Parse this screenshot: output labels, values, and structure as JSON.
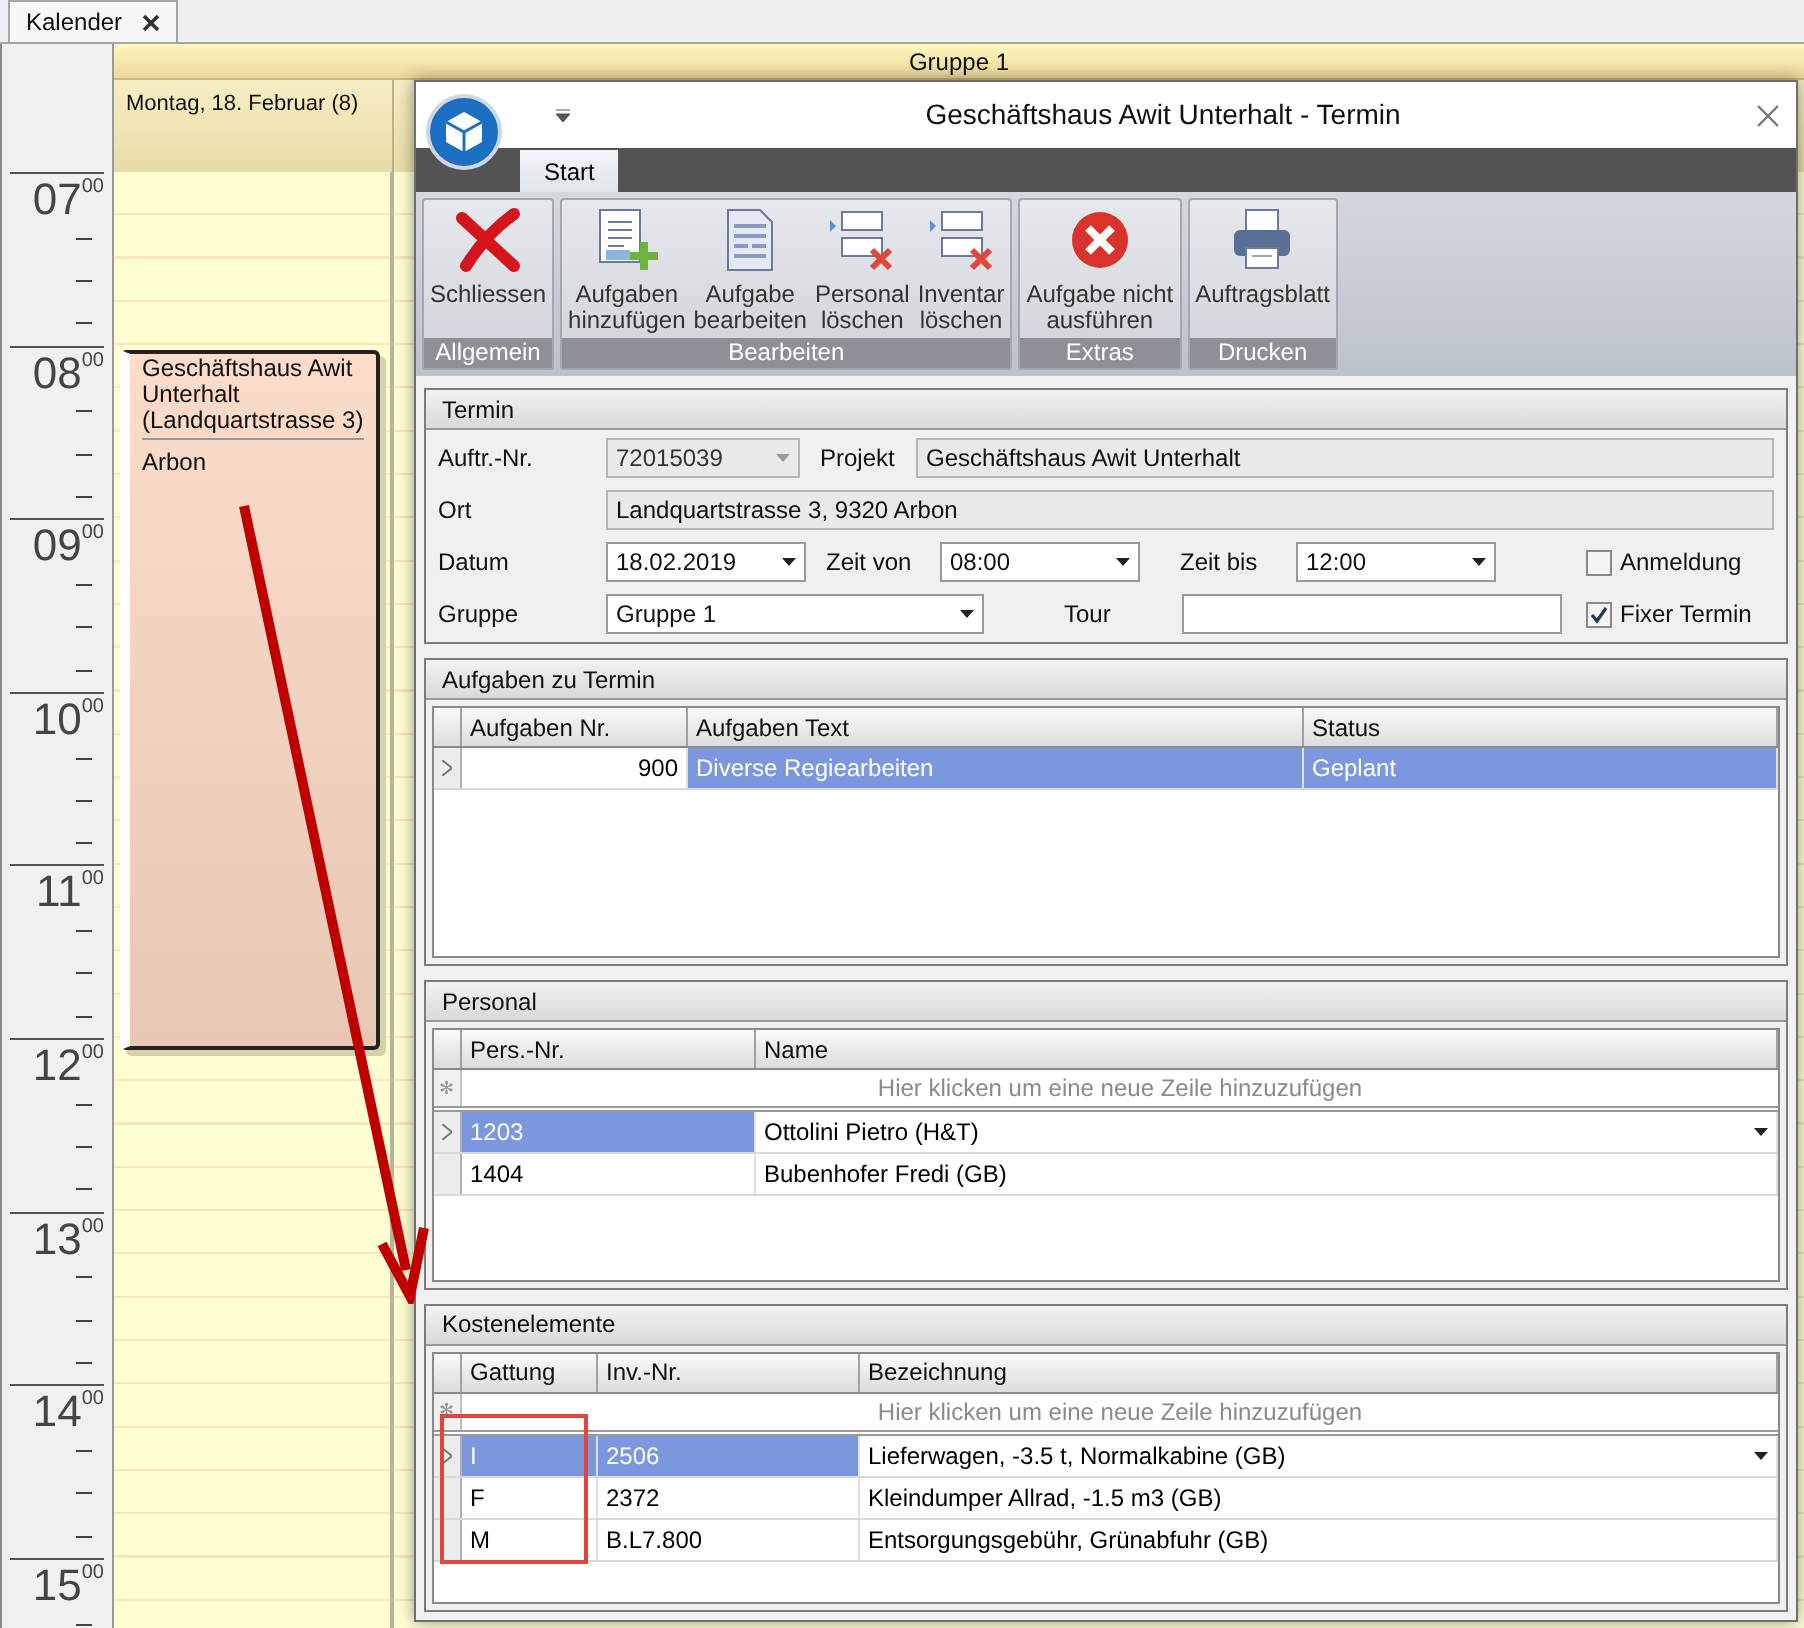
{
  "document_tab": {
    "label": "Kalender"
  },
  "calendar": {
    "group": "Gruppe 1",
    "day_headers": [
      {
        "label": "Montag, 18. Februar (8)"
      }
    ],
    "hours": [
      {
        "hour": "07",
        "minutes": "00"
      },
      {
        "hour": "08",
        "minutes": "00"
      },
      {
        "hour": "09",
        "minutes": "00"
      },
      {
        "hour": "10",
        "minutes": "00"
      },
      {
        "hour": "11",
        "minutes": "00"
      },
      {
        "hour": "12",
        "minutes": "00"
      },
      {
        "hour": "13",
        "minutes": "00"
      },
      {
        "hour": "14",
        "minutes": "00"
      },
      {
        "hour": "15",
        "minutes": "00"
      }
    ],
    "appointment": {
      "title": "Geschäftshaus Awit Unterhalt (Landquartstrasse 3)",
      "location": "Arbon"
    }
  },
  "dialog": {
    "title": "Geschäftshaus Awit Unterhalt - Termin",
    "ribbon_tabs": [
      {
        "label": "Start",
        "selected": true
      }
    ],
    "ribbon_groups": [
      {
        "label": "Allgemein",
        "buttons": [
          {
            "label": "Schliessen",
            "kind": "cross"
          }
        ]
      },
      {
        "label": "Bearbeiten",
        "buttons": [
          {
            "label": "Aufgaben\nhinzufügen",
            "kind": "add-doc"
          },
          {
            "label": "Aufgabe\nbearbeiten",
            "kind": "doc"
          },
          {
            "label": "Personal\nlöschen",
            "kind": "remove-rows"
          },
          {
            "label": "Inventar\nlöschen",
            "kind": "remove-rows"
          }
        ]
      },
      {
        "label": "Extras",
        "buttons": [
          {
            "label": "Aufgabe nicht\nausführen",
            "kind": "stop"
          }
        ]
      },
      {
        "label": "Drucken",
        "buttons": [
          {
            "label": "Auftragsblatt",
            "kind": "printer"
          }
        ]
      }
    ],
    "termin": {
      "title": "Termin",
      "auftr_nr": {
        "label": "Auftr.-Nr.",
        "value": "72015039",
        "disabled": true
      },
      "projekt": {
        "label": "Projekt",
        "value": "Geschäftshaus Awit Unterhalt"
      },
      "ort": {
        "label": "Ort",
        "value": "Landquartstrasse 3, 9320 Arbon"
      },
      "datum": {
        "label": "Datum",
        "value": "18.02.2019"
      },
      "zeit_von": {
        "label": "Zeit von",
        "value": "08:00"
      },
      "zeit_bis": {
        "label": "Zeit bis",
        "value": "12:00"
      },
      "gruppe": {
        "label": "Gruppe",
        "value": "Gruppe 1"
      },
      "tour": {
        "label": "Tour"
      },
      "anmeldung": {
        "label": "Anmeldung",
        "checked": false
      },
      "fixer_termin": {
        "label": "Fixer Termin",
        "checked": true
      }
    },
    "tables": [
      {
        "title": "Aufgaben zu Termin",
        "columns": [
          {
            "label": "Aufgaben Nr.",
            "kind": "number"
          },
          {
            "label": "Aufgaben Text",
            "kind": "text"
          },
          {
            "label": "Status",
            "kind": "text"
          }
        ],
        "rows": [
          {
            "selected": true,
            "cells": [
              {
                "text": "900",
                "focused": true,
                "dropdown": false
              },
              {
                "text": "Diverse Regiearbeiten",
                "focused": false,
                "dropdown": false
              },
              {
                "text": "Geplant",
                "focused": false,
                "dropdown": false
              }
            ]
          }
        ]
      },
      {
        "title": "Personal",
        "columns": [
          {
            "label": "Pers.-Nr."
          },
          {
            "label": "Name"
          }
        ],
        "new_row_marker": "✻",
        "new_row_hint": "Hier klicken um eine neue Zeile hinzuzufügen",
        "rows": [
          {
            "selected": true,
            "cells": [
              {
                "text": "1203",
                "focused": false,
                "dropdown": false
              },
              {
                "text": "Ottolini Pietro (H&T)",
                "focused": true,
                "dropdown": true
              }
            ]
          },
          {
            "selected": false,
            "cells": [
              {
                "text": "1404",
                "dropdown": false
              },
              {
                "text": "Bubenhofer Fredi (GB)",
                "dropdown": false
              }
            ]
          }
        ]
      },
      {
        "title": "Kostenelemente",
        "columns": [
          {
            "label": "Gattung"
          },
          {
            "label": "Inv.-Nr."
          },
          {
            "label": "Bezeichnung"
          }
        ],
        "new_row_marker": "✻",
        "new_row_hint": "Hier klicken um eine neue Zeile hinzuzufügen",
        "rows": [
          {
            "selected": true,
            "cells": [
              {
                "text": "I",
                "focused": false,
                "dropdown": false
              },
              {
                "text": "2506",
                "focused": false,
                "dropdown": false
              },
              {
                "text": "Lieferwagen, -3.5 t, Normalkabine (GB)",
                "focused": true,
                "dropdown": true
              }
            ]
          },
          {
            "selected": false,
            "cells": [
              {
                "text": "F",
                "dropdown": false
              },
              {
                "text": "2372",
                "dropdown": false
              },
              {
                "text": "Kleindumper Allrad, -1.5 m3 (GB)",
                "dropdown": false
              }
            ]
          },
          {
            "selected": false,
            "cells": [
              {
                "text": "M",
                "dropdown": false
              },
              {
                "text": "B.L7.800",
                "dropdown": false
              },
              {
                "text": "Entsorgungsgebühr, Grünabfuhr (GB)",
                "dropdown": false
              }
            ]
          }
        ]
      }
    ]
  }
}
